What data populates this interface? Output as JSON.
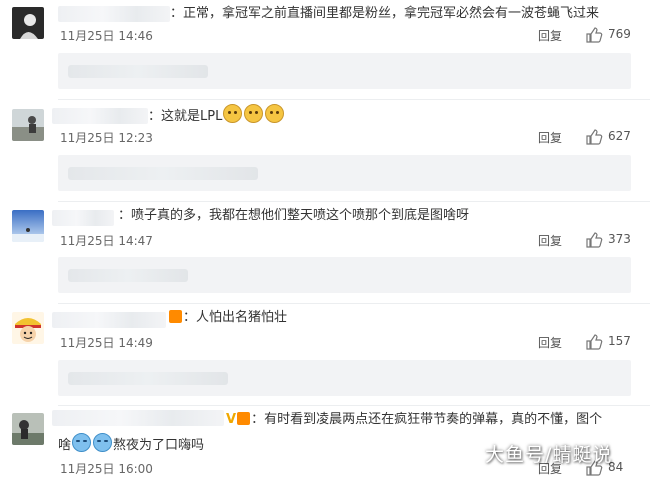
{
  "labels": {
    "reply": "回复",
    "colon": "："
  },
  "comments": [
    {
      "text": "正常，拿冠军之前直播间里都是粉丝，拿完冠军必然会有一波苍蝇飞过来",
      "time": "11月25日 14:46",
      "likes": "769"
    },
    {
      "text": "这就是LPL",
      "time": "11月25日 12:23",
      "likes": "627",
      "emojis": [
        "dog-emoji",
        "dog-emoji",
        "dog-emoji"
      ]
    },
    {
      "text": "喷子真的多，我都在想他们整天喷这个喷那个到底是图啥呀",
      "time": "11月25日 14:47",
      "likes": "373"
    },
    {
      "text": "人怕出名猪怕壮",
      "time": "11月25日 14:49",
      "likes": "157"
    },
    {
      "text_line1": "有时看到凌晨两点还在疯狂带节奏的弹幕，真的不懂，图个",
      "text_line2_a": "啥",
      "text_line2_b": "熬夜为了口嗨吗",
      "time": "11月25日 16:00",
      "likes": "84",
      "emojis": [
        "cry-emoji",
        "cry-emoji"
      ]
    }
  ],
  "watermark": "大鱼号/蜻蜓说",
  "colors": {
    "background": "#ffffff",
    "subreply_box": "#f2f3f5",
    "text": "#333333",
    "meta": "#666666"
  }
}
